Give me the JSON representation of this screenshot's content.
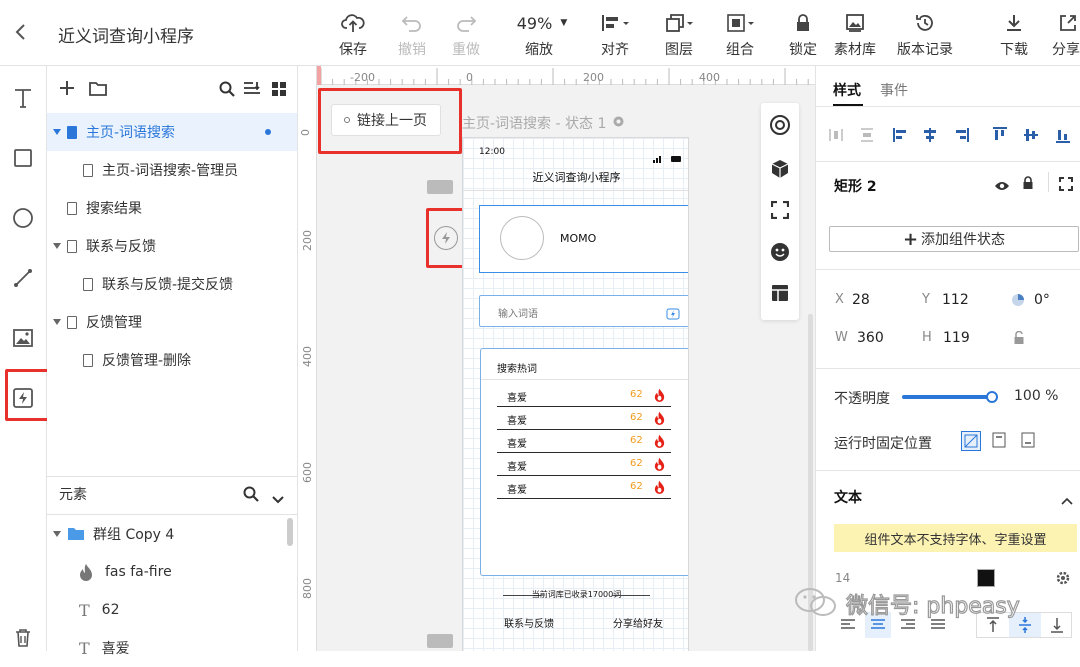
{
  "app": {
    "title": "近义词查询小程序"
  },
  "toolbar": [
    {
      "id": "save",
      "label": "保存",
      "icon": "upload-cloud-icon",
      "disabled": false
    },
    {
      "id": "undo",
      "label": "撤销",
      "icon": "undo-icon",
      "disabled": true
    },
    {
      "id": "redo",
      "label": "重做",
      "icon": "redo-icon",
      "disabled": true
    },
    {
      "id": "zoom",
      "label": "缩放",
      "value": "49%",
      "icon": "zoom-dropdown"
    },
    {
      "id": "align",
      "label": "对齐",
      "icon": "align-left-icon"
    },
    {
      "id": "layer",
      "label": "图层",
      "icon": "layer-icon"
    },
    {
      "id": "group",
      "label": "组合",
      "icon": "group-icon"
    },
    {
      "id": "lock",
      "label": "锁定",
      "icon": "lock-icon"
    },
    {
      "id": "assets",
      "label": "素材库",
      "icon": "image-icon"
    },
    {
      "id": "history",
      "label": "版本记录",
      "icon": "history-icon"
    },
    {
      "id": "download",
      "label": "下载",
      "icon": "download-icon"
    },
    {
      "id": "share",
      "label": "分享",
      "icon": "share-icon"
    }
  ],
  "pages": [
    {
      "label": "主页-词语搜索",
      "level": 0,
      "selected": true,
      "caret": true
    },
    {
      "label": "主页-词语搜索-管理员",
      "level": 1
    },
    {
      "label": "搜索结果",
      "level": 0
    },
    {
      "label": "联系与反馈",
      "level": 0,
      "caret": true
    },
    {
      "label": "联系与反馈-提交反馈",
      "level": 1
    },
    {
      "label": "反馈管理",
      "level": 0,
      "caret": true
    },
    {
      "label": "反馈管理-删除",
      "level": 1
    }
  ],
  "elements_panel": {
    "title": "元素",
    "items": [
      {
        "label": "群组 Copy 4",
        "icon": "folder-icon",
        "level": 0
      },
      {
        "label": "fas fa-fire",
        "icon": "fire-icon",
        "level": 1
      },
      {
        "label": "62",
        "icon": "text-icon",
        "level": 1
      },
      {
        "label": "喜爱",
        "icon": "text-icon",
        "level": 1
      }
    ]
  },
  "canvas": {
    "ruler_x": [
      "-200",
      "0",
      "200",
      "400"
    ],
    "ruler_y": [
      "0",
      "200",
      "400",
      "600",
      "800"
    ],
    "link_prev": "链接上一页",
    "state_label": "主页-词语搜索 - 状态 1",
    "phone": {
      "time": "12:00",
      "title": "近义词查询小程序",
      "profile_name": "MOMO",
      "search_placeholder": "输入词语",
      "hot_title": "搜索热词",
      "hot_words": [
        {
          "word": "喜爱",
          "count": "62"
        },
        {
          "word": "喜爱",
          "count": "62"
        },
        {
          "word": "喜爱",
          "count": "62"
        },
        {
          "word": "喜爱",
          "count": "62"
        },
        {
          "word": "喜爱",
          "count": "62"
        }
      ],
      "footer_text": "当前词库已收录17000词",
      "bottom_left": "联系与反馈",
      "bottom_right": "分享给好友"
    }
  },
  "right": {
    "tabs": [
      "样式",
      "事件"
    ],
    "shape_name": "矩形 2",
    "add_state": "添加组件状态",
    "x_label": "X",
    "x": "28",
    "y_label": "Y",
    "y": "112",
    "rotation": "0°",
    "w_label": "W",
    "w": "360",
    "h_label": "H",
    "h": "119",
    "opacity_label": "不透明度",
    "opacity": "100 %",
    "opacity_value": 1.0,
    "fixed_label": "运行时固定位置",
    "text_section": "文本",
    "text_notice": "组件文本不支持字体、字重设置",
    "font_size": "14",
    "text_color": "#111111"
  },
  "watermark": "微信号: phpeasy",
  "accent": "#2a77d9",
  "highlight": "#e8312a",
  "fire_color": "#e62117",
  "count_color": "#f29b1f"
}
